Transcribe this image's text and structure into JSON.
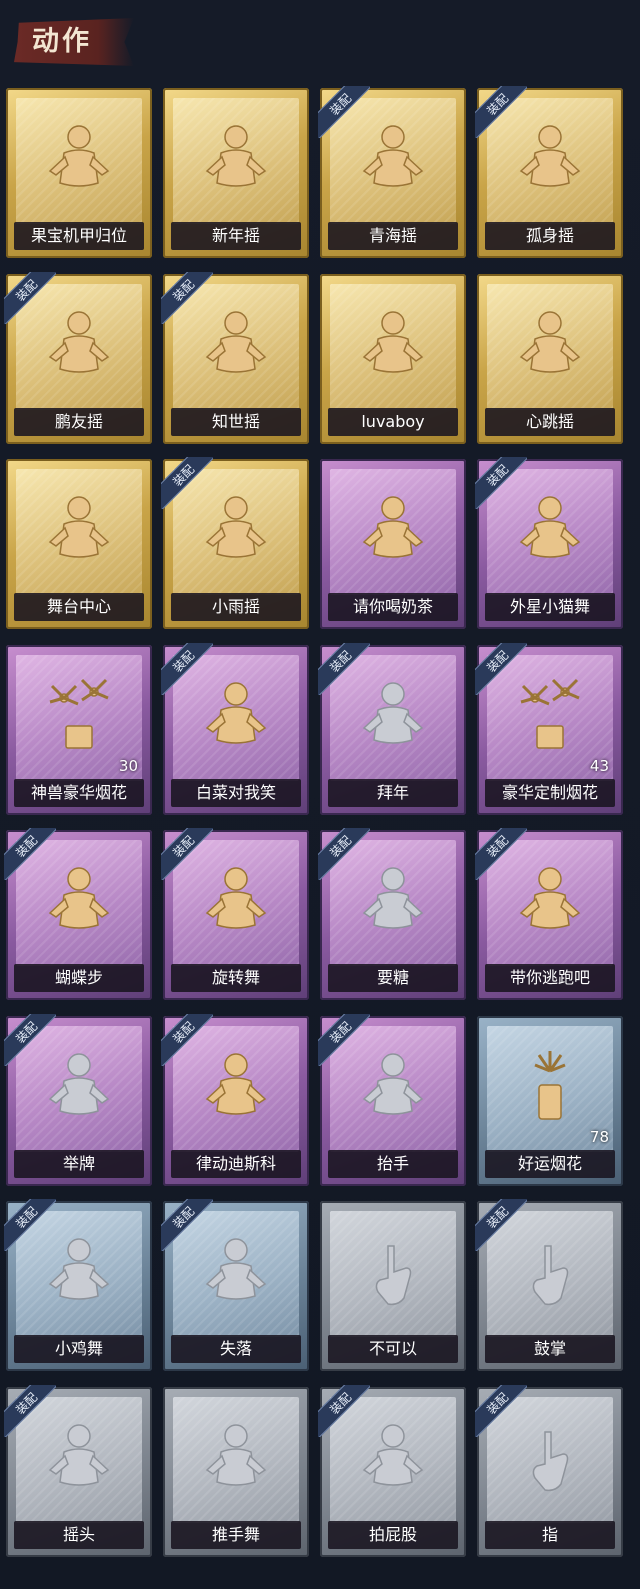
{
  "header": {
    "title": "动作"
  },
  "badge_label": "装配",
  "colors": {
    "gold": "#c9a448",
    "purple": "#8a5aa0",
    "blue": "#6b8398",
    "gray": "#7d848e",
    "icon_gold": "#e8c48a",
    "icon_gray": "#c9ccd3"
  },
  "cards": [
    {
      "label": "果宝机甲归位",
      "rarity": "gold",
      "equipped": false,
      "icon": "figure-icon"
    },
    {
      "label": "新年摇",
      "rarity": "gold",
      "equipped": false,
      "icon": "figure-icon"
    },
    {
      "label": "青海摇",
      "rarity": "gold",
      "equipped": true,
      "icon": "figure-icon"
    },
    {
      "label": "孤身摇",
      "rarity": "gold",
      "equipped": true,
      "icon": "figure-icon"
    },
    {
      "label": "鹏友摇",
      "rarity": "gold",
      "equipped": true,
      "icon": "figure-icon"
    },
    {
      "label": "知世摇",
      "rarity": "gold",
      "equipped": true,
      "icon": "figure-icon"
    },
    {
      "label": "luvaboy",
      "rarity": "gold",
      "equipped": false,
      "icon": "figure-icon"
    },
    {
      "label": "心跳摇",
      "rarity": "gold",
      "equipped": false,
      "icon": "figure-icon"
    },
    {
      "label": "舞台中心",
      "rarity": "gold",
      "equipped": false,
      "icon": "figure-icon"
    },
    {
      "label": "小雨摇",
      "rarity": "gold",
      "equipped": true,
      "icon": "figure-icon"
    },
    {
      "label": "请你喝奶茶",
      "rarity": "purple",
      "equipped": false,
      "icon": "figure-icon"
    },
    {
      "label": "外星小猫舞",
      "rarity": "purple",
      "equipped": true,
      "icon": "figure-icon"
    },
    {
      "label": "神兽豪华烟花",
      "rarity": "purple",
      "equipped": false,
      "icon": "fireworks-icon",
      "count": "30"
    },
    {
      "label": "白菜对我笑",
      "rarity": "purple",
      "equipped": true,
      "icon": "figure-icon"
    },
    {
      "label": "拜年",
      "rarity": "purple",
      "equipped": true,
      "icon": "figure-icon",
      "muted": true
    },
    {
      "label": "豪华定制烟花",
      "rarity": "purple",
      "equipped": true,
      "icon": "fireworks-icon",
      "count": "43"
    },
    {
      "label": "蝴蝶步",
      "rarity": "purple",
      "equipped": true,
      "icon": "figure-icon"
    },
    {
      "label": "旋转舞",
      "rarity": "purple",
      "equipped": true,
      "icon": "figure-icon"
    },
    {
      "label": "要糖",
      "rarity": "purple",
      "equipped": true,
      "icon": "figure-icon",
      "muted": true
    },
    {
      "label": "带你逃跑吧",
      "rarity": "purple",
      "equipped": true,
      "icon": "figure-icon"
    },
    {
      "label": "举牌",
      "rarity": "purple",
      "equipped": true,
      "icon": "figure-icon",
      "muted": true
    },
    {
      "label": "律动迪斯科",
      "rarity": "purple",
      "equipped": true,
      "icon": "figure-icon"
    },
    {
      "label": "抬手",
      "rarity": "purple",
      "equipped": true,
      "icon": "figure-icon",
      "muted": true
    },
    {
      "label": "好运烟花",
      "rarity": "blue",
      "equipped": false,
      "icon": "firework-can-icon",
      "count": "78"
    },
    {
      "label": "小鸡舞",
      "rarity": "blue",
      "equipped": true,
      "icon": "figure-icon",
      "muted": true
    },
    {
      "label": "失落",
      "rarity": "blue",
      "equipped": true,
      "icon": "figure-icon",
      "muted": true
    },
    {
      "label": "不可以",
      "rarity": "gray",
      "equipped": false,
      "icon": "hand-icon",
      "muted": true
    },
    {
      "label": "鼓掌",
      "rarity": "gray",
      "equipped": true,
      "icon": "hand-icon",
      "muted": true
    },
    {
      "label": "摇头",
      "rarity": "gray",
      "equipped": true,
      "icon": "figure-icon",
      "muted": true
    },
    {
      "label": "推手舞",
      "rarity": "gray",
      "equipped": false,
      "icon": "figure-icon",
      "muted": true
    },
    {
      "label": "拍屁股",
      "rarity": "gray",
      "equipped": true,
      "icon": "figure-icon",
      "muted": true
    },
    {
      "label": "指",
      "rarity": "gray",
      "equipped": true,
      "icon": "hand-icon",
      "muted": true
    }
  ]
}
